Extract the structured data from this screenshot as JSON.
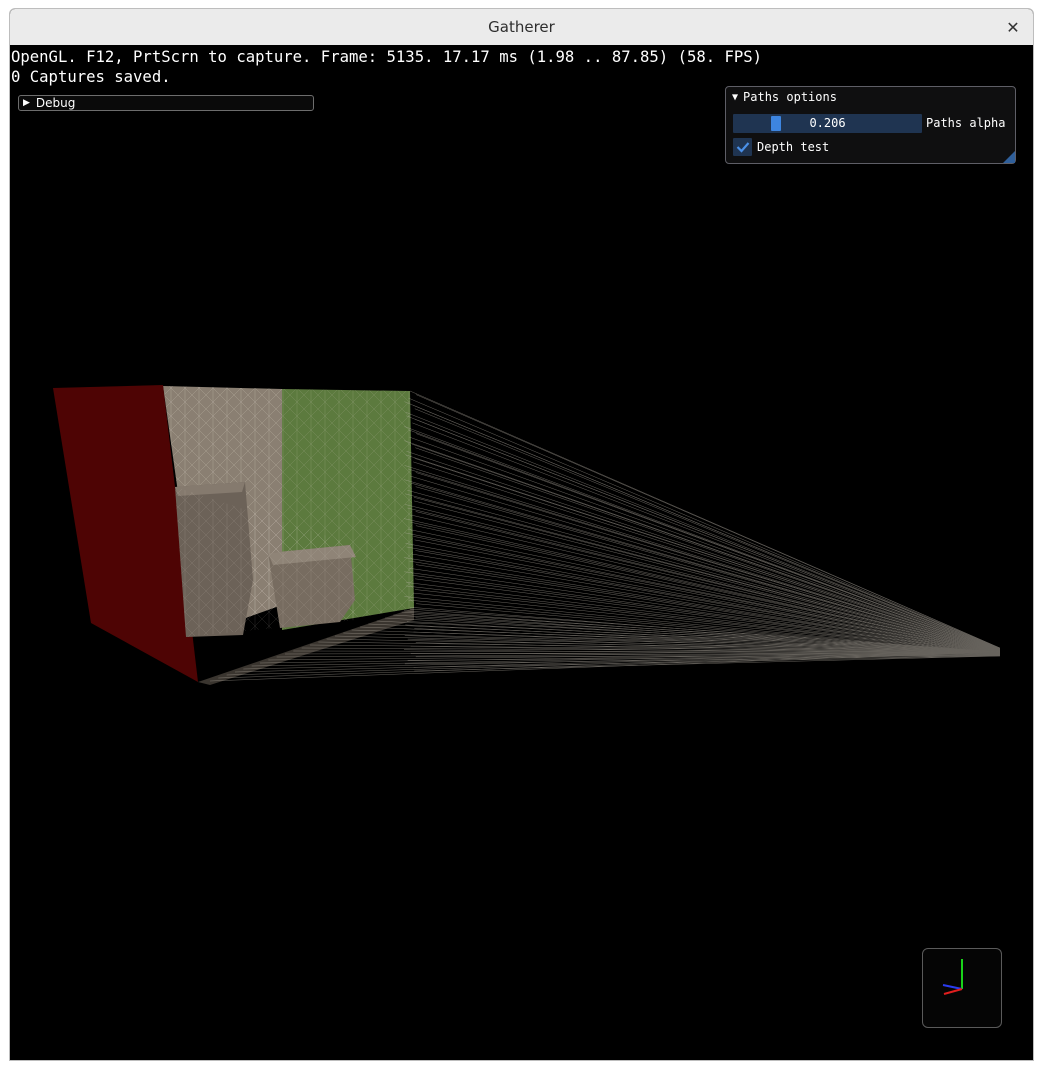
{
  "window": {
    "title": "Gatherer"
  },
  "overlay": {
    "line1": "OpenGL. F12, PrtScrn to capture. Frame: 5135. 17.17 ms (1.98 .. 87.85) (58. FPS)",
    "line2": "0 Captures saved."
  },
  "debug": {
    "label": "Debug",
    "arrow": "▶"
  },
  "paths_panel": {
    "title": "Paths options",
    "arrow": "▼",
    "slider_value": "0.206",
    "slider_fraction": 0.206,
    "slider_label": "Paths alpha",
    "depth_test_label": "Depth test",
    "depth_test_checked": true
  },
  "colors": {
    "red_wall": "#4e0404",
    "green_wall": "#5c7a3e",
    "back_wall": "#8a7f72",
    "accent": "#3d85e0"
  },
  "icons": {
    "close": "close-icon",
    "gizmo": "axis-gizmo-icon"
  }
}
